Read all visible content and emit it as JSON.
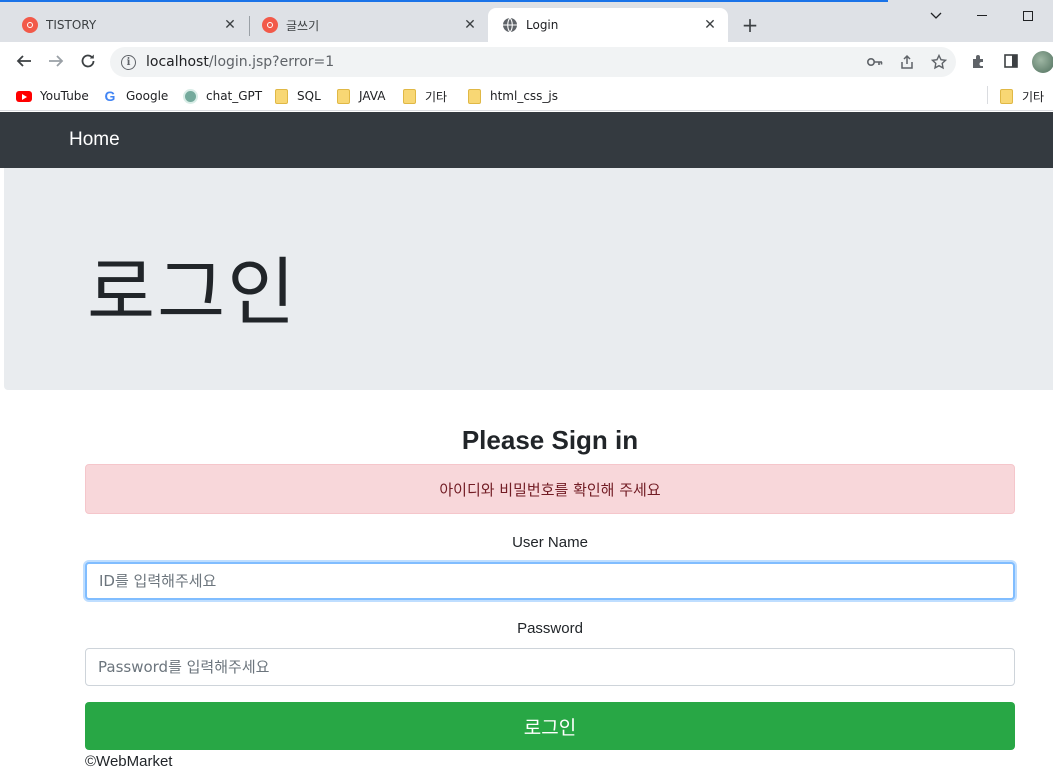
{
  "browser": {
    "tabs": [
      {
        "title": "TISTORY",
        "favicon": "tistory-icon",
        "active": false
      },
      {
        "title": "글쓰기",
        "favicon": "tistory-icon",
        "active": false
      },
      {
        "title": "Login",
        "favicon": "globe-icon",
        "active": true
      }
    ],
    "url_host": "localhost",
    "url_path": "/login.jsp?error=1",
    "bookmarks": [
      {
        "label": "YouTube",
        "icon": "youtube-icon"
      },
      {
        "label": "Google",
        "icon": "google-icon"
      },
      {
        "label": "chat_GPT",
        "icon": "chatgpt-icon"
      },
      {
        "label": "SQL",
        "icon": "folder-icon"
      },
      {
        "label": "JAVA",
        "icon": "folder-icon"
      },
      {
        "label": "기타",
        "icon": "folder-icon"
      },
      {
        "label": "html_css_js",
        "icon": "folder-icon"
      },
      {
        "label": "기타",
        "icon": "folder-icon"
      }
    ],
    "accent_color": "#1a73e8"
  },
  "page": {
    "navbar": {
      "brand": "Home",
      "color": "#343a40"
    },
    "jumbotron": {
      "title": "로그인"
    },
    "form": {
      "heading": "Please Sign in",
      "error": "아이디와 비밀번호를 확인해 주세요",
      "username_label": "User Name",
      "username_placeholder": "ID를 입력해주세요",
      "password_label": "Password",
      "password_placeholder": "Password를 입력해주세요",
      "submit_label": "로그인",
      "submit_color": "#28a745"
    },
    "footer": "©WebMarket"
  }
}
